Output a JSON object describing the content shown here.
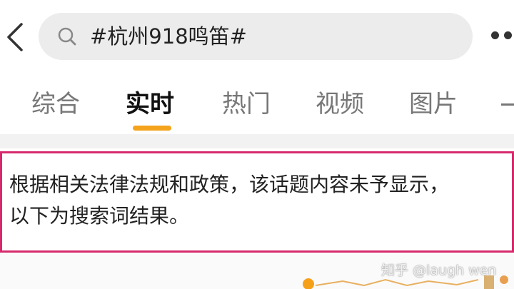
{
  "search": {
    "query": "#杭州918鸣笛#"
  },
  "tabs": [
    {
      "label": "综合"
    },
    {
      "label": "实时"
    },
    {
      "label": "热门"
    },
    {
      "label": "视频"
    },
    {
      "label": "图片"
    }
  ],
  "active_tab": "实时",
  "notice": {
    "line1": "根据相关法律法规和政策，该话题内容未予显示，",
    "line2": "以下为搜索词结果。"
  },
  "watermark": "知乎 @laugh wen",
  "colors": {
    "accent": "#f4a31c",
    "notice_border": "#d62a6d",
    "search_bg": "#ececec"
  }
}
